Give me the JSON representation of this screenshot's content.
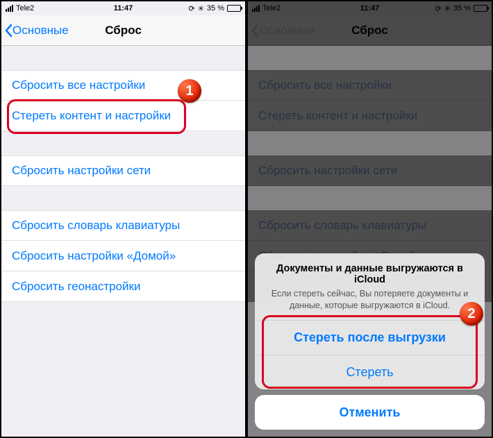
{
  "status": {
    "carrier": "Tele2",
    "time": "11:47",
    "battery_pct": "35 %"
  },
  "nav": {
    "back": "Основные",
    "title": "Сброс"
  },
  "groups": [
    {
      "items": [
        {
          "label": "Сбросить все настройки"
        },
        {
          "label": "Стереть контент и настройки"
        }
      ]
    },
    {
      "items": [
        {
          "label": "Сбросить настройки сети"
        }
      ]
    },
    {
      "items": [
        {
          "label": "Сбросить словарь клавиатуры"
        },
        {
          "label": "Сбросить настройки «Домой»"
        },
        {
          "label": "Сбросить геонастройки"
        }
      ]
    }
  ],
  "sheet": {
    "title": "Документы и данные выгружаются в iCloud",
    "message": "Если стереть сейчас, Вы потеряете документы и данные, которые выгружаются в iCloud.",
    "primary": "Стереть после выгрузки",
    "secondary": "Стереть",
    "cancel": "Отменить"
  },
  "badges": {
    "one": "1",
    "two": "2"
  }
}
